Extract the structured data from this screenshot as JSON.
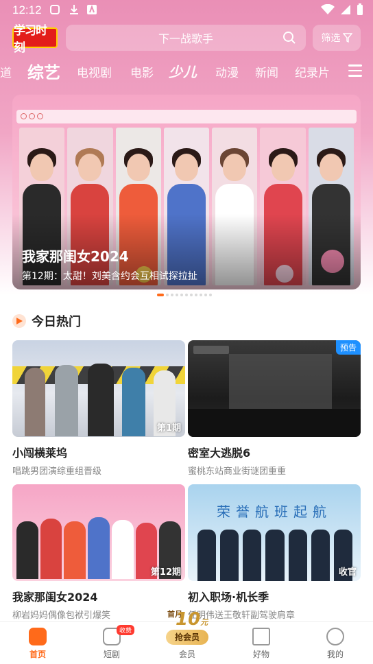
{
  "status_bar": {
    "time": "12:12"
  },
  "header": {
    "logo_text": "学习时刻",
    "search_placeholder": "下一战歌手",
    "filter_label": "筛选"
  },
  "tabs": [
    {
      "label": "道"
    },
    {
      "label": "综艺",
      "active": true
    },
    {
      "label": "电视剧"
    },
    {
      "label": "电影"
    },
    {
      "label": "少儿"
    },
    {
      "label": "动漫"
    },
    {
      "label": "新闻"
    },
    {
      "label": "纪录片"
    }
  ],
  "banner": {
    "title": "我家那闺女2024",
    "subtitle": "第12期：太甜！刘美含约会互相试探拉扯",
    "active_index": 0,
    "count": 11
  },
  "section": {
    "title": "今日热门"
  },
  "cards": [
    {
      "title": "小闯横莱坞",
      "subtitle": "唱跳男团演综重组晋级",
      "episode": "第1期",
      "badge": ""
    },
    {
      "title": "密室大逃脱6",
      "subtitle": "蜜桃东站商业街谜团重重",
      "episode": "",
      "badge": "预告"
    },
    {
      "title": "我家那闺女2024",
      "subtitle": "柳岩妈妈偶像包袱引爆笑",
      "episode": "第12期",
      "badge": ""
    },
    {
      "title": "初入职场·机长季",
      "subtitle": "任明伟送王敬轩副驾驶肩章",
      "episode": "收官",
      "badge": ""
    }
  ],
  "card_thumbs": {
    "card2_overlay": "荣誉航班起航"
  },
  "bottom_nav": {
    "home": "首页",
    "drama": "短剧",
    "drama_tag": "收费",
    "vip_prefix": "首月",
    "vip_number": "10",
    "vip_unit": "元",
    "vip_button": "抢会员",
    "vip_label": "会员",
    "shop": "好物",
    "mine": "我的"
  },
  "colors": {
    "accent": "#ff6a1a",
    "header_pink": "#ea8fb6",
    "badge_blue": "#1e90ff"
  }
}
